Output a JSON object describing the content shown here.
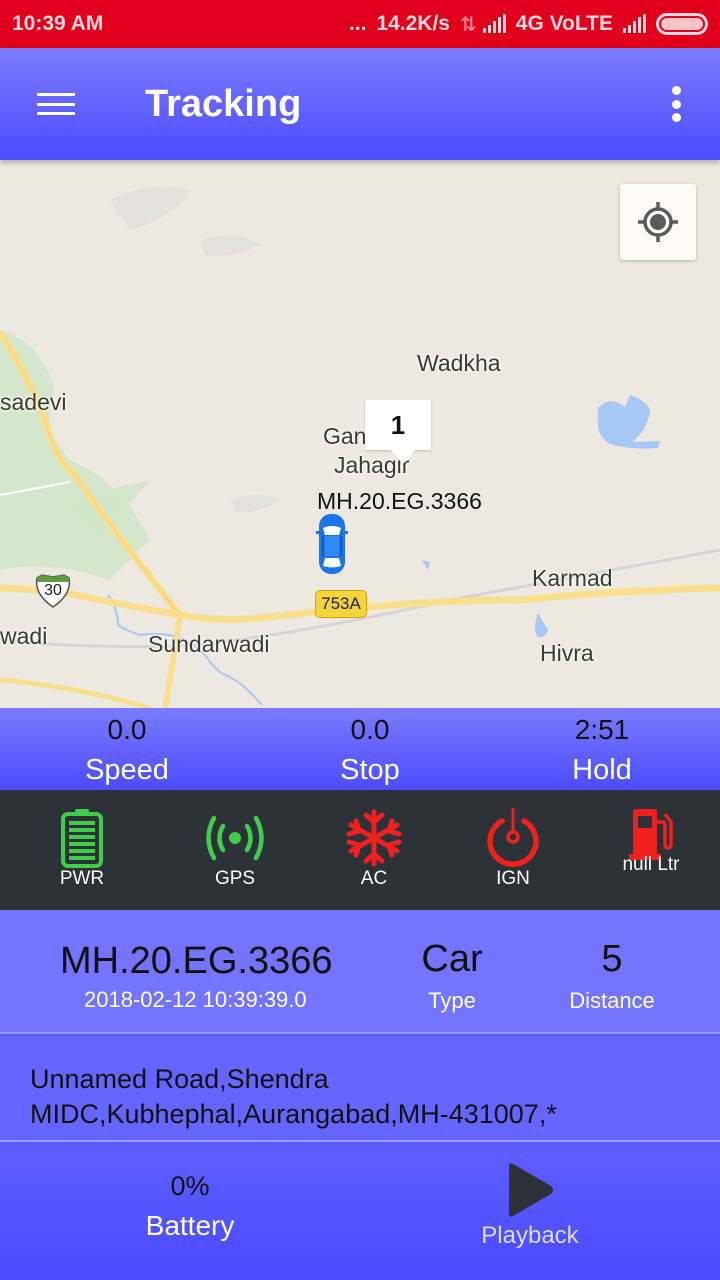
{
  "status_bar": {
    "time": "10:39 AM",
    "dots": "...",
    "network_speed": "14.2K/s",
    "network_type": "4G VoLTE"
  },
  "app_bar": {
    "title": "Tracking",
    "menu_icon": "hamburger-menu-icon",
    "more_icon": "more-vert-icon"
  },
  "map": {
    "locate_icon": "my-location-icon",
    "labels": {
      "wadkha": "Wadkha",
      "sadevi": "sadevi",
      "gan": "Gan",
      "jahagir": "Jahagir",
      "karmad": "Karmad",
      "wadi": "wadi",
      "sundarwadi": "Sundarwadi",
      "hivra": "Hivra"
    },
    "route_shields": {
      "nh30": "30",
      "r753a": "753A"
    },
    "info_bubble": "1",
    "vehicle_label": "MH.20.EG.3366"
  },
  "stats": [
    {
      "value": "0.0",
      "label": "Speed"
    },
    {
      "value": "0.0",
      "label": "Stop"
    },
    {
      "value": "2:51",
      "label": "Hold"
    }
  ],
  "indicators": [
    {
      "label": "PWR",
      "icon": "battery-full-icon",
      "color": "#3ecf4a"
    },
    {
      "label": "GPS",
      "icon": "gps-signal-icon",
      "color": "#3ecf4a"
    },
    {
      "label": "AC",
      "icon": "snowflake-icon",
      "color": "#f0201e"
    },
    {
      "label": "IGN",
      "icon": "power-icon",
      "color": "#f0201e"
    },
    {
      "label": "null Ltr",
      "icon": "fuel-pump-icon",
      "color": "#f0201e"
    }
  ],
  "vehicle": {
    "plate": "MH.20.EG.3366",
    "timestamp": "2018-02-12 10:39:39.0",
    "type_value": "Car",
    "type_label": "Type",
    "distance_value": "5",
    "distance_label": "Distance"
  },
  "address": {
    "line1": "Unnamed Road,Shendra",
    "line2": "MIDC,Kubhephal,Aurangabad,MH-431007,*"
  },
  "bottom": {
    "battery_value": "0%",
    "battery_label": "Battery",
    "playback_label": "Playback",
    "playback_icon": "play-icon"
  }
}
